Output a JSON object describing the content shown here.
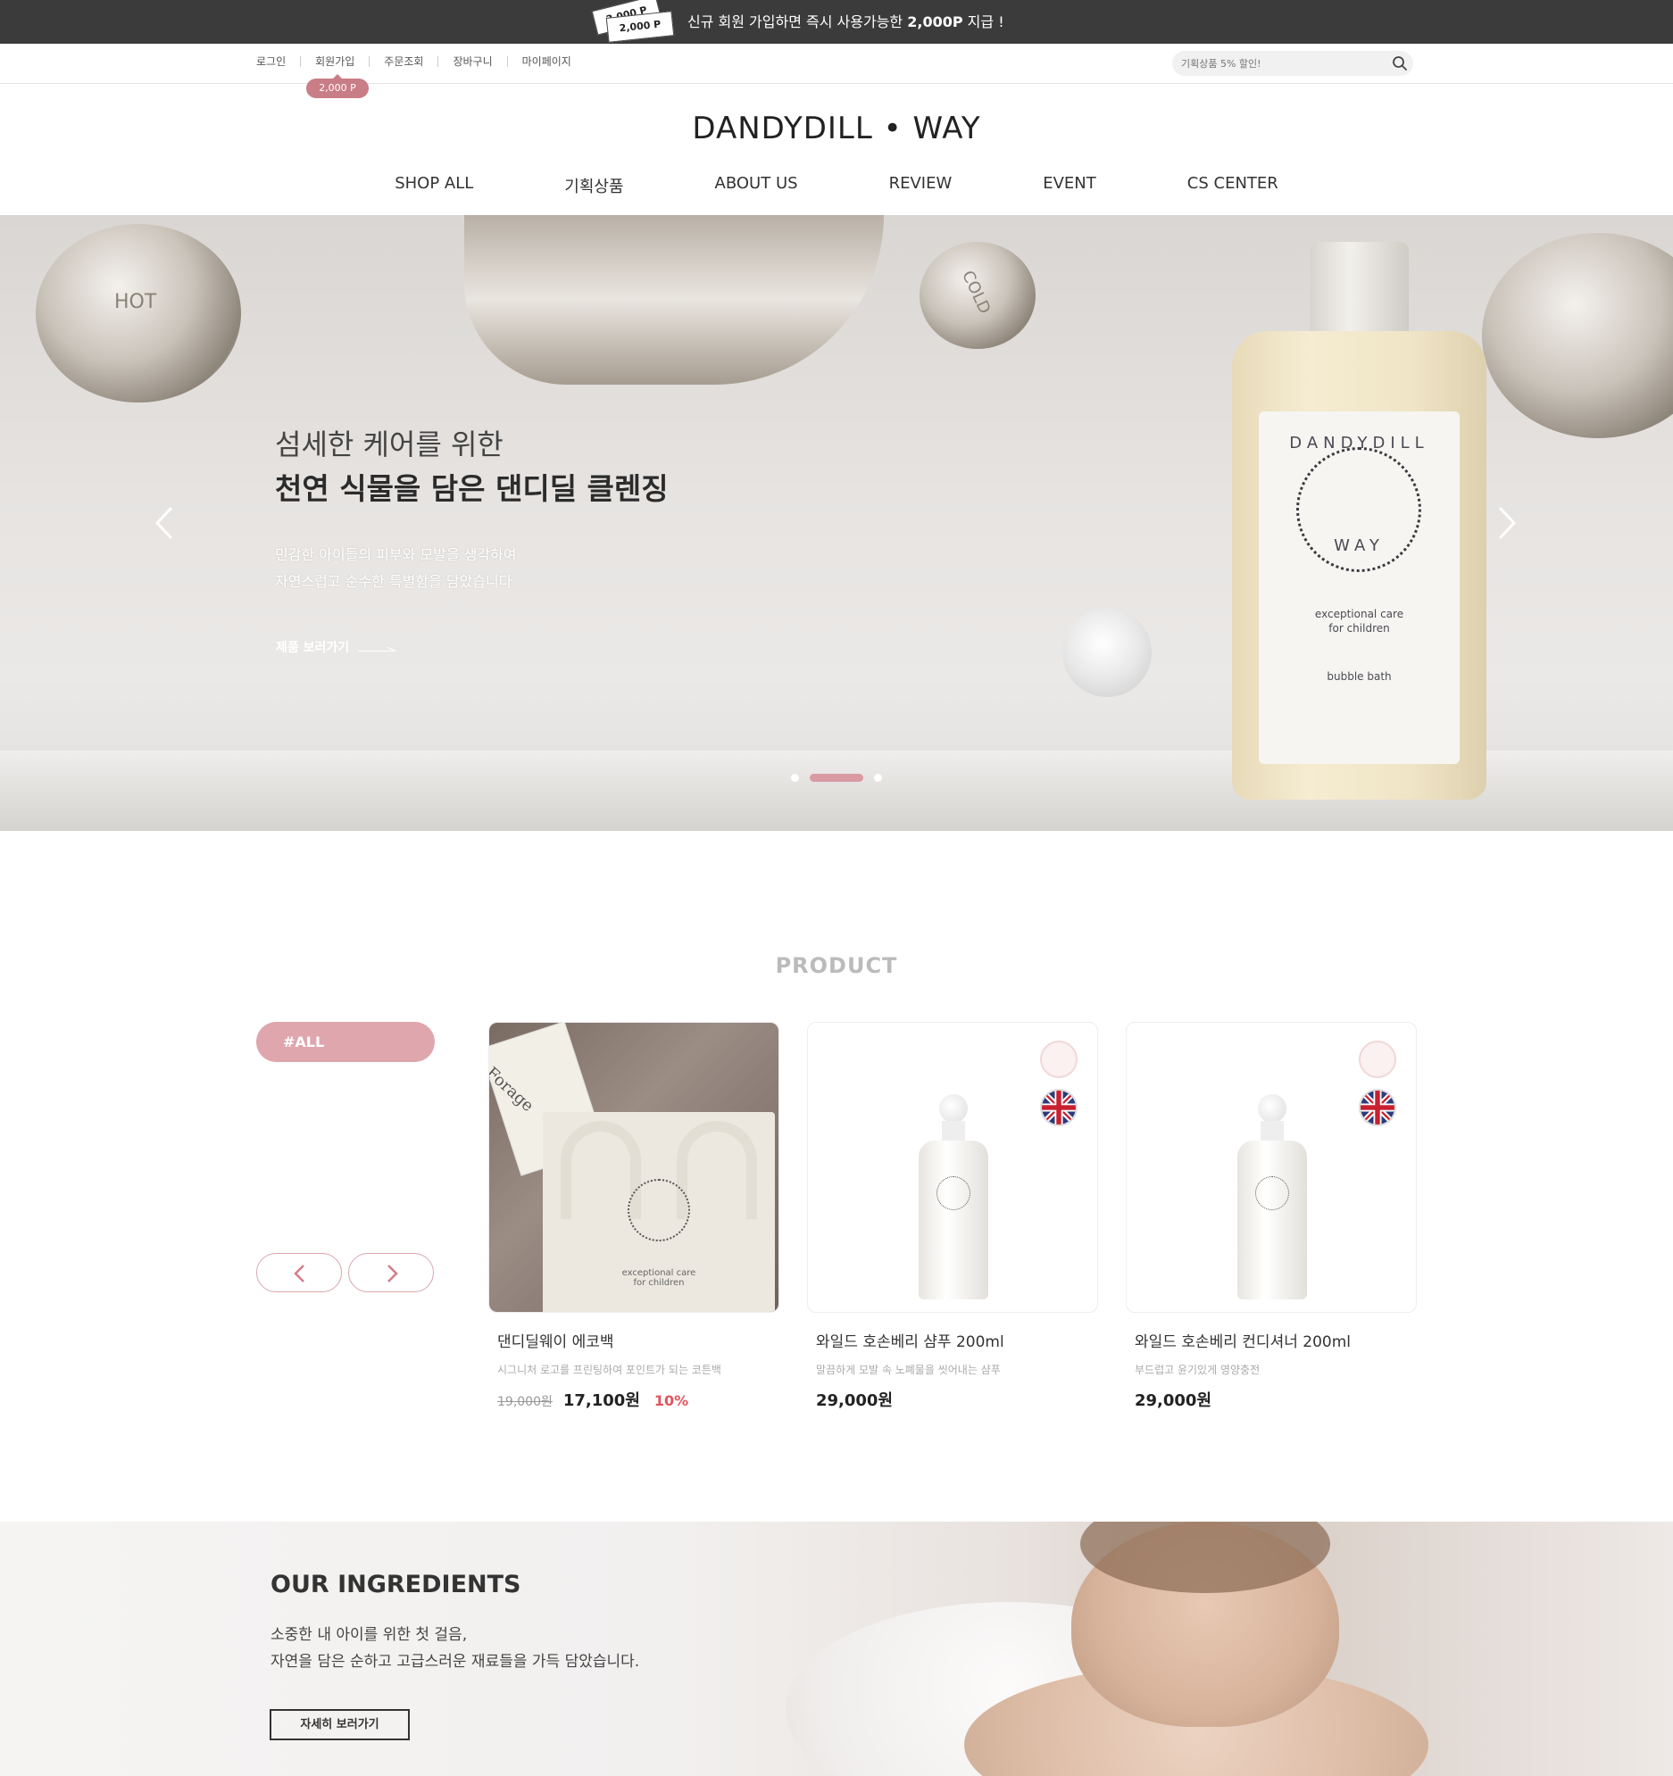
{
  "promo": {
    "ticket_front": "2,000 P",
    "ticket_back": "2,000 P",
    "text_before": "신규 회원 가입하면 즉시 사용가능한 ",
    "text_bold": "2,000P",
    "text_after": " 지급 !"
  },
  "util_nav": {
    "links": [
      "로그인",
      "회원가입",
      "주문조회",
      "장바구니",
      "마이페이지"
    ],
    "join_badge": "2,000 P",
    "search_placeholder": "기획상품 5% 할인!"
  },
  "logo": "DANDYDILL • WAY",
  "gnb": [
    "SHOP ALL",
    "기획상품",
    "ABOUT US",
    "REVIEW",
    "EVENT",
    "CS CENTER"
  ],
  "hero": {
    "subtitle": "섬세한 케어를 위한",
    "title": "천연 식물을 담은 댄디딜 클렌징",
    "desc_line1": "민감한 아이들의 피부와 모발을 생각하여",
    "desc_line2": "자연스럽고 순수한 특별함을 담았습니다",
    "link": "제품 보러가기",
    "bottle_label": {
      "brand_top": "DANDYDILL",
      "brand_bottom": "WAY",
      "tagline1": "exceptional care",
      "tagline2": "for children",
      "product": "bubble bath"
    },
    "tap_labels": [
      "HOT",
      "COLD"
    ],
    "slides": 3,
    "active_slide": 2
  },
  "product_section": {
    "title": "PRODUCT",
    "category": "#ALL",
    "products": [
      {
        "name": "댄디딜웨이 에코백",
        "desc": "시그니처 로고를 프린팅하여 포인트가 되는 코튼백",
        "original_price": "19,000원",
        "price": "17,100원",
        "discount": "10%",
        "thumb_book": "Forage",
        "thumb_tag1": "exceptional care",
        "thumb_tag2": "for children"
      },
      {
        "name": "와일드 호손베리 샴푸 200ml",
        "desc": "말끔하게 모발 속 노폐물을 씻어내는 샴푸",
        "price": "29,000원"
      },
      {
        "name": "와일드 호손베리 컨디셔너 200ml",
        "desc": "부드럽고 윤기있게 영양충전",
        "price": "29,000원"
      }
    ]
  },
  "ingredients": {
    "title": "OUR INGREDIENTS",
    "line1": "소중한 내 아이를 위한 첫 걸음,",
    "line2": "자연을 담은 순하고 고급스러운 재료들을 가득 담았습니다.",
    "button": "자세히 보러가기"
  },
  "colors": {
    "promo_bg": "#3b3b3b",
    "accent_pink": "#dfa6ad",
    "badge_pink": "#c97d86",
    "discount_red": "#e0555e"
  }
}
